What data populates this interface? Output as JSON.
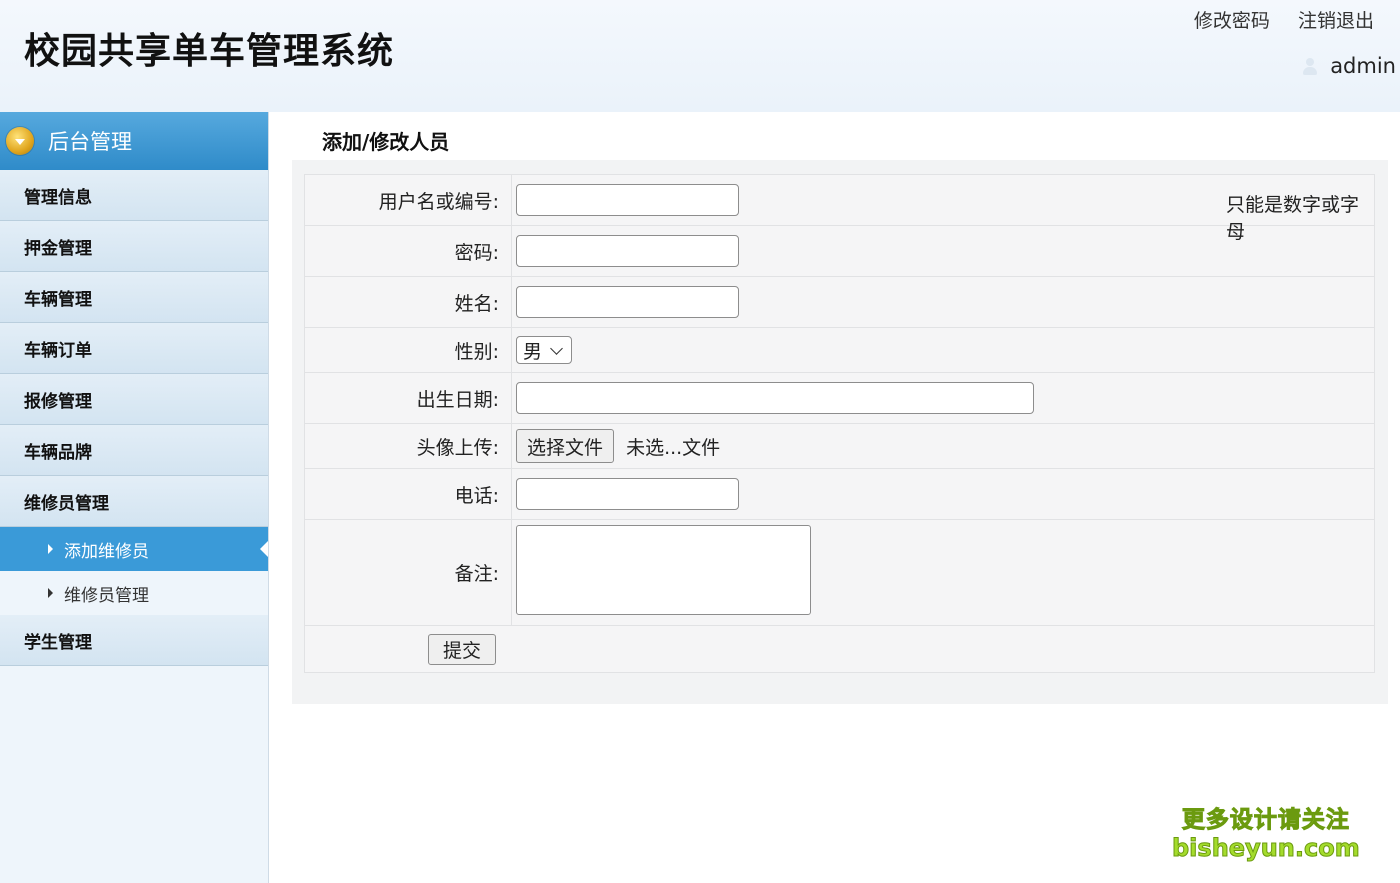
{
  "header": {
    "app_title": "校园共享单车管理系统",
    "links": [
      "修改密码",
      "注销退出"
    ],
    "username": "admin"
  },
  "sidebar": {
    "head_label": "后台管理",
    "menus": [
      {
        "label": "管理信息"
      },
      {
        "label": "押金管理"
      },
      {
        "label": "车辆管理"
      },
      {
        "label": "车辆订单"
      },
      {
        "label": "报修管理"
      },
      {
        "label": "车辆品牌"
      },
      {
        "label": "维修员管理",
        "children": [
          {
            "label": "添加维修员",
            "active": true
          },
          {
            "label": "维修员管理",
            "active": false
          }
        ]
      },
      {
        "label": "学生管理"
      }
    ]
  },
  "main": {
    "page_title": "添加/修改人员",
    "form": {
      "username_label": "用户名或编号:",
      "username_hint": "只能是数字或字母",
      "password_label": "密码:",
      "name_label": "姓名:",
      "gender_label": "性别:",
      "gender_value": "男",
      "birthdate_label": "出生日期:",
      "avatar_label": "头像上传:",
      "file_button": "选择文件",
      "file_status": "未选...文件",
      "phone_label": "电话:",
      "remark_label": "备注:",
      "submit_label": "提交"
    }
  },
  "watermark": {
    "line1": "更多设计请关注",
    "line2": "bisheyun.com"
  },
  "colors": {
    "accent": "#3a9ad8",
    "sidebar_bg": "#eef5fb",
    "panel_bg": "#f2f3f4"
  }
}
